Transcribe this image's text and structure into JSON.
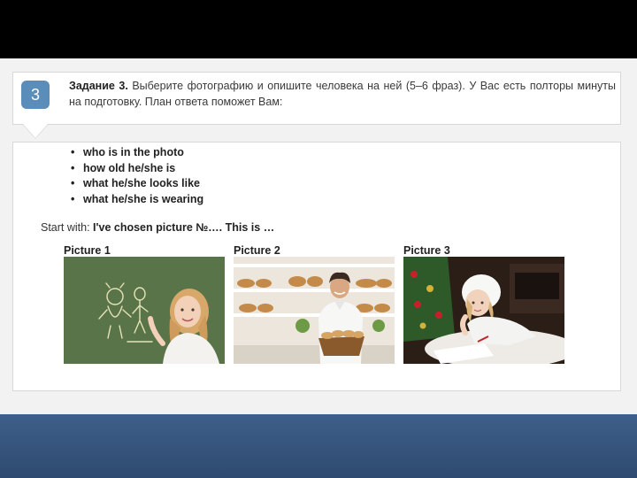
{
  "task": {
    "number": "3",
    "title": "Задание 3.",
    "text": " Выберите фотографию и опишите человека на ней (5–6 фраз). У Вас есть полторы минуты на подготовку. План ответа поможет Вам:"
  },
  "plan": {
    "bullet": "•",
    "items": [
      "who is in the photo",
      "how old he/she is",
      "what he/she looks like",
      "what he/she is wearing"
    ]
  },
  "start": {
    "prefix": "Start with: ",
    "phrase": "I've chosen picture №…. This is …"
  },
  "pictures": [
    {
      "label": "Picture 1"
    },
    {
      "label": "Picture 2"
    },
    {
      "label": "Picture 3"
    }
  ],
  "colors": {
    "task_number_bg": "#5b8dbb",
    "top_band": "#000000",
    "bottom_band": "#3e5f8a",
    "chalkboard": "#5f7a4e"
  }
}
